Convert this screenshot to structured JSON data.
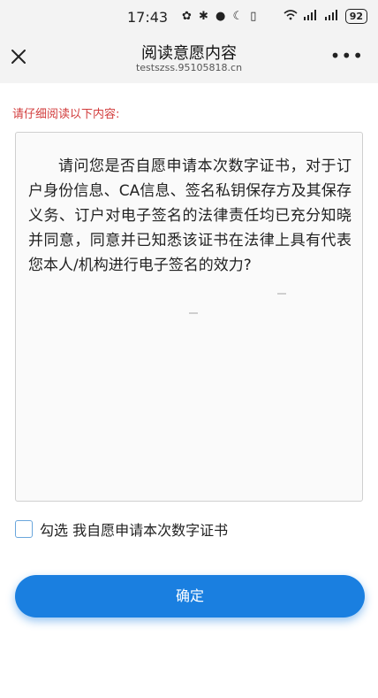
{
  "status_bar": {
    "time": "17:43",
    "battery": "92"
  },
  "nav": {
    "title": "阅读意愿内容",
    "subtitle": "testszss.95105818.cn"
  },
  "instruction": "请仔细阅读以下内容:",
  "content_text": "请问您是否自愿申请本次数字证书，对于订户身份信息、CA信息、签名私钥保存方及其保存义务、订户对电子签名的法律责任均已充分知晓并同意，同意并已知悉该证书在法律上具有代表您本人/机构进行电子签名的效力?",
  "checkbox": {
    "label": "勾选 我自愿申请本次数字证书",
    "checked": false
  },
  "confirm_button": "确定",
  "colors": {
    "accent": "#1a7fe0",
    "instruction": "#d23c3c",
    "checkbox_border": "#6aa6dc"
  }
}
